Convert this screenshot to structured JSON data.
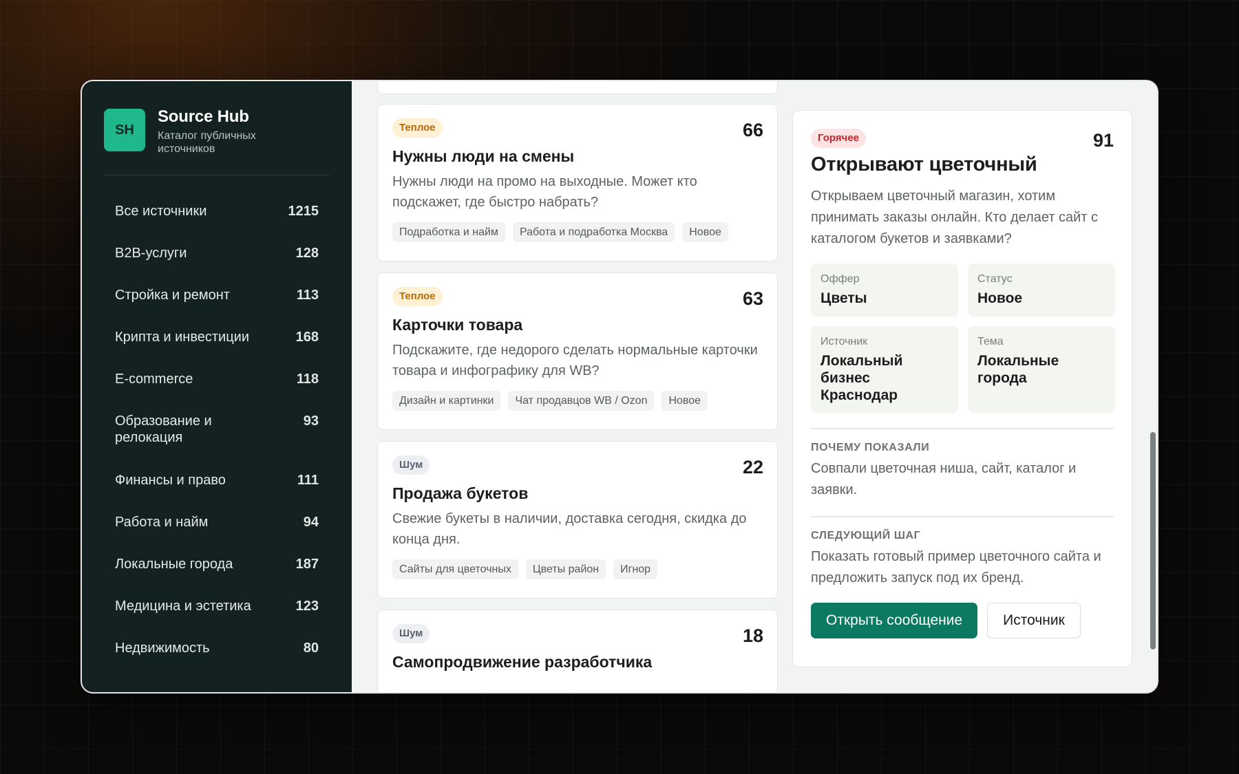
{
  "brand": {
    "logo": "SH",
    "name": "Source Hub",
    "subtitle": "Каталог публичных источников"
  },
  "sidebar": {
    "items": [
      {
        "label": "Все источники",
        "count": "1215"
      },
      {
        "label": "B2B-услуги",
        "count": "128"
      },
      {
        "label": "Стройка и ремонт",
        "count": "113"
      },
      {
        "label": "Крипта и инвестиции",
        "count": "168"
      },
      {
        "label": "E-commerce",
        "count": "118"
      },
      {
        "label": "Образование и релокация",
        "count": "93"
      },
      {
        "label": "Финансы и право",
        "count": "111"
      },
      {
        "label": "Работа и найм",
        "count": "94"
      },
      {
        "label": "Локальные города",
        "count": "187"
      },
      {
        "label": "Медицина и эстетика",
        "count": "123"
      },
      {
        "label": "Недвижимость",
        "count": "80"
      }
    ]
  },
  "cards": [
    {
      "badge": "Теплое",
      "score": "66",
      "title": "Нужны люди на смены",
      "text": "Нужны люди на промо на выходные. Может кто подскажет, где быстро набрать?",
      "tags": [
        "Подработка и найм",
        "Работа и подработка Москва",
        "Новое"
      ]
    },
    {
      "badge": "Теплое",
      "score": "63",
      "title": "Карточки товара",
      "text": "Подскажите, где недорого сделать нормальные карточки товара и инфографику для WB?",
      "tags": [
        "Дизайн и картинки",
        "Чат продавцов WB / Ozon",
        "Новое"
      ]
    },
    {
      "badge": "Шум",
      "score": "22",
      "title": "Продажа букетов",
      "text": "Свежие букеты в наличии, доставка сегодня, скидка до конца дня.",
      "tags": [
        "Сайты для цветочных",
        "Цветы район",
        "Игнор"
      ]
    },
    {
      "badge": "Шум",
      "score": "18",
      "title": "Самопродвижение разработчика"
    }
  ],
  "detail": {
    "badge": "Горячее",
    "score": "91",
    "title": "Открывают цветочный",
    "text": "Открываем цветочный магазин, хотим принимать заказы онлайн. Кто делает сайт с каталогом букетов и заявками?",
    "facts": [
      {
        "label": "Оффер",
        "value": "Цветы"
      },
      {
        "label": "Статус",
        "value": "Новое"
      },
      {
        "label": "Источник",
        "value": "Локальный бизнес Краснодар"
      },
      {
        "label": "Тема",
        "value": "Локальные города"
      }
    ],
    "why_title": "ПОЧЕМУ ПОКАЗАЛИ",
    "why_text": "Совпали цветочная ниша, сайт, каталог и заявки.",
    "next_title": "СЛЕДУЮЩИЙ ШАГ",
    "next_text": "Показать готовый пример цветочного сайта и предложить запуск под их бренд.",
    "open_label": "Открыть сообщение",
    "source_label": "Источник"
  }
}
